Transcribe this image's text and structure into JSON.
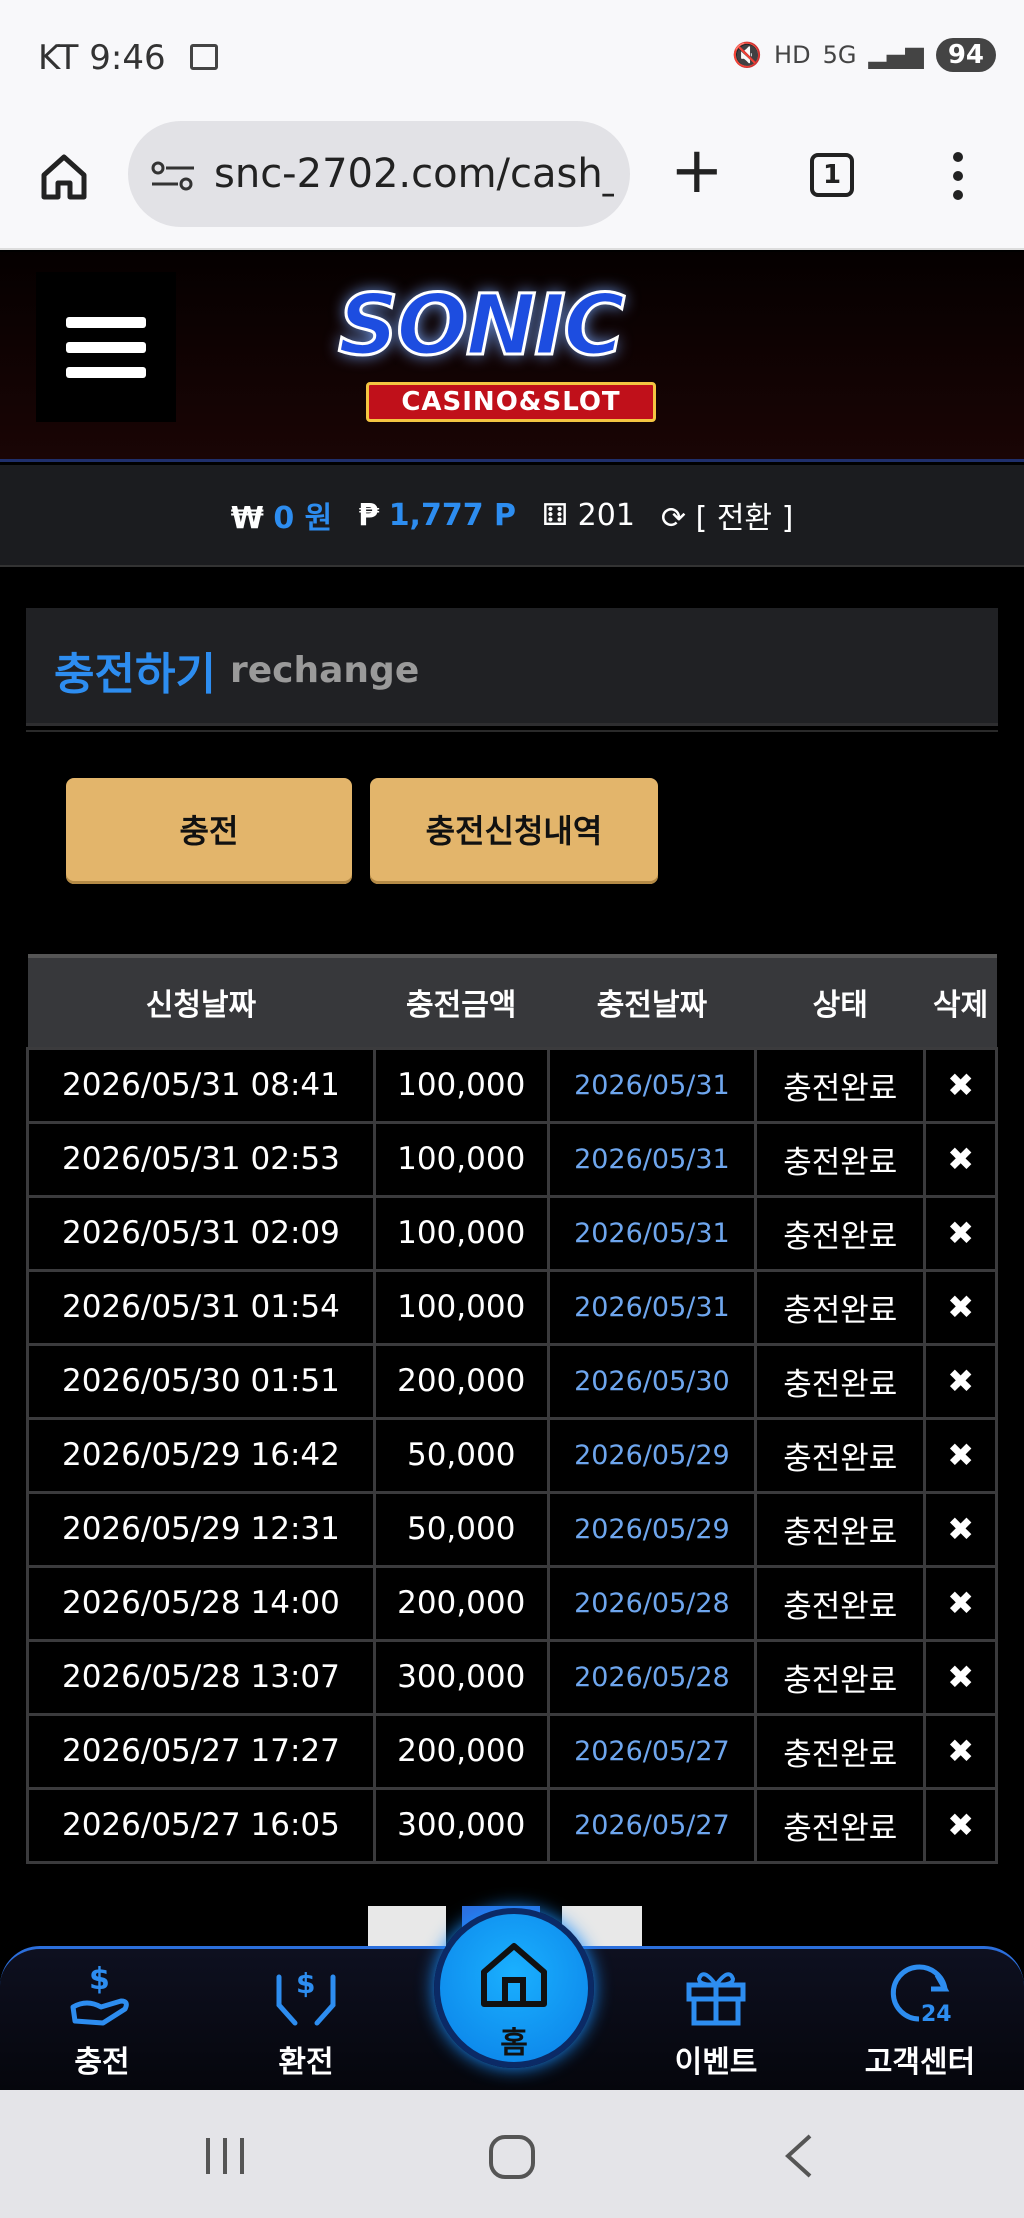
{
  "status_bar": {
    "carrier": "KT",
    "time": "9:46",
    "battery": "94",
    "network": "5G"
  },
  "browser": {
    "url": "snc-2702.com/cash_",
    "tab_count": "1"
  },
  "logo": {
    "main": "SONIC",
    "sub": "CASINO&SLOT"
  },
  "balance": {
    "won_symbol": "₩",
    "won_value": "0 원",
    "point_symbol": "₱",
    "point_value": "1,777 P",
    "chip_value": "201",
    "convert_label": "[ 전환 ]"
  },
  "section": {
    "title": "충전하기",
    "subtitle": "rechange"
  },
  "buttons": {
    "charge": "충전",
    "history": "충전신청내역"
  },
  "table": {
    "headers": [
      "신청날짜",
      "충전금액",
      "충전날짜",
      "상태",
      "삭제"
    ],
    "rows": [
      {
        "req": "2026/05/31 08:41",
        "amount": "100,000",
        "date": "2026/05/31",
        "status": "충전완료",
        "del": "✖"
      },
      {
        "req": "2026/05/31 02:53",
        "amount": "100,000",
        "date": "2026/05/31",
        "status": "충전완료",
        "del": "✖"
      },
      {
        "req": "2026/05/31 02:09",
        "amount": "100,000",
        "date": "2026/05/31",
        "status": "충전완료",
        "del": "✖"
      },
      {
        "req": "2026/05/31 01:54",
        "amount": "100,000",
        "date": "2026/05/31",
        "status": "충전완료",
        "del": "✖"
      },
      {
        "req": "2026/05/30 01:51",
        "amount": "200,000",
        "date": "2026/05/30",
        "status": "충전완료",
        "del": "✖"
      },
      {
        "req": "2026/05/29 16:42",
        "amount": "50,000",
        "date": "2026/05/29",
        "status": "충전완료",
        "del": "✖"
      },
      {
        "req": "2026/05/29 12:31",
        "amount": "50,000",
        "date": "2026/05/29",
        "status": "충전완료",
        "del": "✖"
      },
      {
        "req": "2026/05/28 14:00",
        "amount": "200,000",
        "date": "2026/05/28",
        "status": "충전완료",
        "del": "✖"
      },
      {
        "req": "2026/05/28 13:07",
        "amount": "300,000",
        "date": "2026/05/28",
        "status": "충전완료",
        "del": "✖"
      },
      {
        "req": "2026/05/27 17:27",
        "amount": "200,000",
        "date": "2026/05/27",
        "status": "충전완료",
        "del": "✖"
      },
      {
        "req": "2026/05/27 16:05",
        "amount": "300,000",
        "date": "2026/05/27",
        "status": "충전완료",
        "del": "✖"
      }
    ]
  },
  "bottom_nav": {
    "charge": "충전",
    "exchange": "환전",
    "home": "홈",
    "event": "이벤트",
    "support": "고객센터"
  },
  "colors": {
    "accent_blue": "#2d8df0",
    "button_gold": "#e3b56b",
    "date_blue": "#6ea6ee"
  }
}
